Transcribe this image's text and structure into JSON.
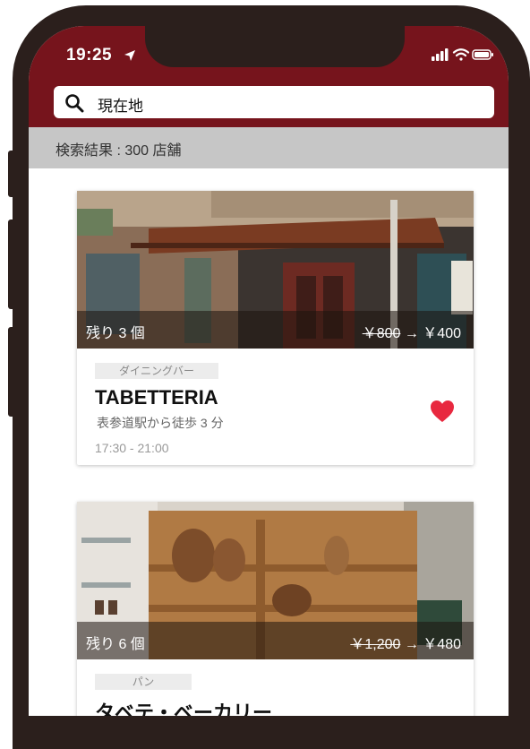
{
  "status_bar": {
    "time": "19:25",
    "icons": [
      "location-arrow-icon",
      "signal-icon",
      "wifi-icon",
      "battery-icon"
    ]
  },
  "search": {
    "value": "現在地",
    "icon": "search-icon"
  },
  "results": {
    "label": "検索結果 : 300 店舗"
  },
  "colors": {
    "header": "#76141c",
    "frame": "#2b1f1c",
    "heart": "#e8283f"
  },
  "shops": [
    {
      "remaining": "残り 3 個",
      "old_price": "￥800",
      "arrow": "→",
      "new_price": "￥400",
      "category": "ダイニングバー",
      "name": "TABETTERIA",
      "access": "表参道駅から徒歩 3 分",
      "hours": "17:30 - 21:00",
      "favorite": true
    },
    {
      "remaining": "残り 6 個",
      "old_price": "￥1,200",
      "arrow": "→",
      "new_price": "￥480",
      "category": "パン",
      "name": "タベテ・ベーカリー"
    }
  ]
}
